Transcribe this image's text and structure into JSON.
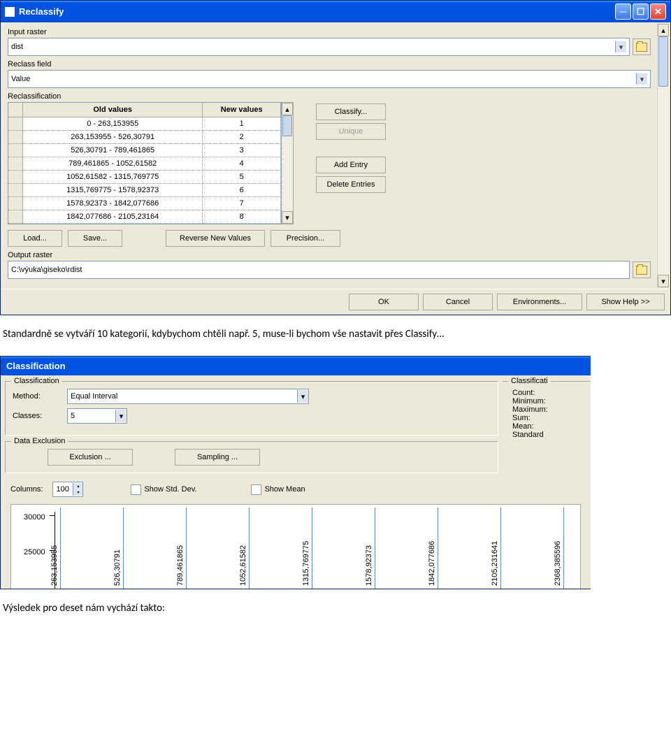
{
  "window1": {
    "title": "Reclassify",
    "input_raster_label": "Input raster",
    "input_raster_value": "dist",
    "reclass_field_label": "Reclass field",
    "reclass_field_value": "Value",
    "reclassification_label": "Reclassification",
    "table": {
      "header_old": "Old values",
      "header_new": "New values",
      "rows": [
        {
          "old": "0 - 263,153955",
          "new": "1"
        },
        {
          "old": "263,153955 - 526,30791",
          "new": "2"
        },
        {
          "old": "526,30791 - 789,461865",
          "new": "3"
        },
        {
          "old": "789,461865 - 1052,61582",
          "new": "4"
        },
        {
          "old": "1052,61582 - 1315,769775",
          "new": "5"
        },
        {
          "old": "1315,769775 - 1578,92373",
          "new": "6"
        },
        {
          "old": "1578,92373 - 1842,077686",
          "new": "7"
        },
        {
          "old": "1842,077686 - 2105,23164",
          "new": "8"
        }
      ]
    },
    "btn_classify": "Classify...",
    "btn_unique": "Unique",
    "btn_add_entry": "Add Entry",
    "btn_delete_entries": "Delete Entries",
    "btn_load": "Load...",
    "btn_save": "Save...",
    "btn_reverse": "Reverse New Values",
    "btn_precision": "Precision...",
    "output_raster_label": "Output raster",
    "output_raster_value": "C:\\výuka\\giseko\\rdist",
    "btn_ok": "OK",
    "btn_cancel": "Cancel",
    "btn_env": "Environments...",
    "btn_help": "Show Help >>"
  },
  "text1": "Standardně se vytváří 10 kategorií, kdybychom chtěli např. 5, muse-li bychom vše nastavit přes Classify…",
  "window2": {
    "title": "Classification",
    "group_classification": "Classification",
    "method_label": "Method:",
    "method_value": "Equal Interval",
    "classes_label": "Classes:",
    "classes_value": "5",
    "group_data_exclusion": "Data Exclusion",
    "btn_exclusion": "Exclusion ...",
    "btn_sampling": "Sampling ...",
    "right_legend": "Classificati",
    "stat_count": "Count:",
    "stat_min": "Minimum:",
    "stat_max": "Maximum:",
    "stat_sum": "Sum:",
    "stat_mean": "Mean:",
    "stat_std": "Standard",
    "columns_label": "Columns:",
    "columns_value": "100",
    "show_std": "Show Std. Dev.",
    "show_mean": "Show Mean",
    "y_ticks": [
      "30000",
      "25000"
    ],
    "vlines": [
      "263,153955",
      "526,30791",
      "789,461865",
      "1052,61582",
      "1315,769775",
      "1578,92373",
      "1842,077686",
      "2105,231641",
      "2368,385596"
    ]
  },
  "text2": "Výsledek pro deset nám vychází takto:"
}
